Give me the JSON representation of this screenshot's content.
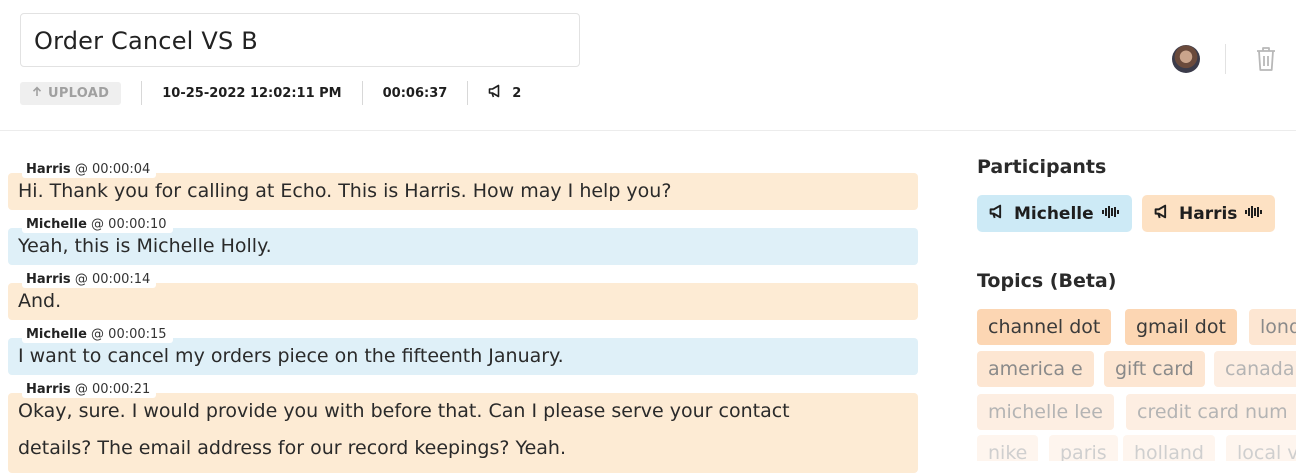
{
  "header": {
    "title": "Order Cancel VS B",
    "upload_label": "UPLOAD",
    "datetime": "10-25-2022 12:02:11 PM",
    "duration": "00:06:37",
    "speaker_count": "2"
  },
  "transcript": [
    {
      "speaker": "Harris",
      "time": "@ 00:00:04",
      "text": "Hi. Thank you for calling at Echo. This is Harris. How may I help you?"
    },
    {
      "speaker": "Michelle",
      "time": "@ 00:00:10",
      "text": "Yeah, this is Michelle Holly."
    },
    {
      "speaker": "Harris",
      "time": "@ 00:00:14",
      "text": "And."
    },
    {
      "speaker": "Michelle",
      "time": "@ 00:00:15",
      "text": "I want to cancel my orders piece on the fifteenth January."
    },
    {
      "speaker": "Harris",
      "time": "@ 00:00:21",
      "text_line1": "Okay, sure. I would provide you with before that. Can I please serve your contact",
      "text_line2": "details? The email address for our record keepings? Yeah."
    }
  ],
  "sidebar": {
    "participants_title": "Participants",
    "participants": [
      "Michelle",
      "Harris"
    ],
    "topics_title": "Topics (Beta)",
    "topics": [
      "channel dot",
      "gmail dot",
      "lond",
      "america e",
      "gift card",
      "canada",
      "michelle lee",
      "credit card num",
      "nike",
      "paris",
      "holland",
      "local v"
    ]
  },
  "colors": {
    "harris": "#fdebd4",
    "michelle": "#dff0f8"
  }
}
